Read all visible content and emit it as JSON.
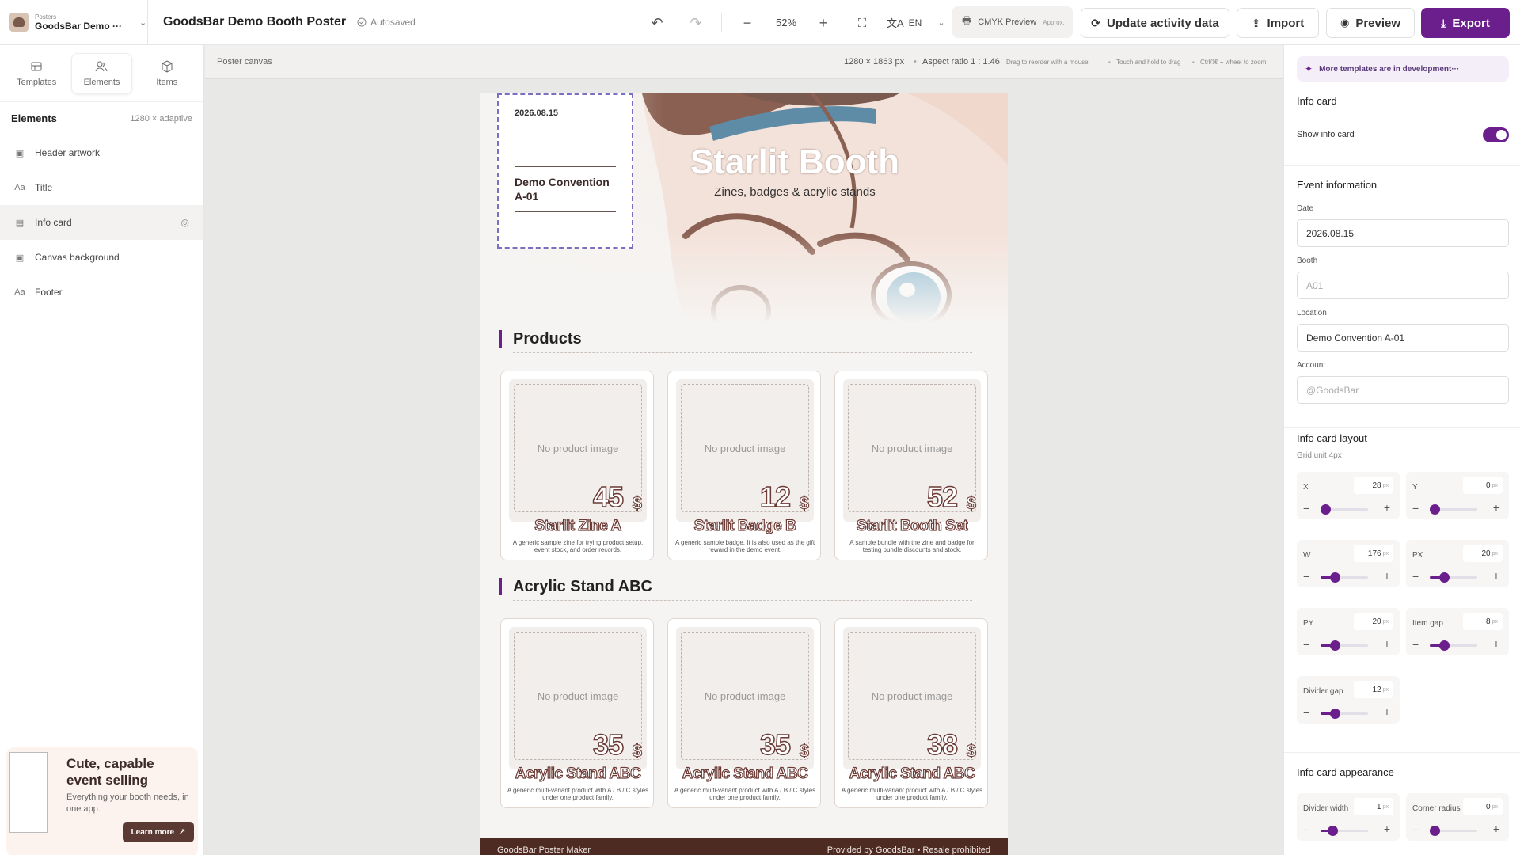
{
  "topbar": {
    "project_small": "Posters",
    "project_name": "GoodsBar Demo ···",
    "doc_title": "GoodsBar Demo Booth Poster",
    "autosaved": "Autosaved",
    "zoom": "52%",
    "lang": "EN",
    "cmyk_label": "CMYK Preview",
    "cmyk_note": "Approx.",
    "update_label": "Update activity data",
    "import_label": "Import",
    "preview_label": "Preview",
    "export_label": "Export",
    "accent_color": "#6b1f8c"
  },
  "left": {
    "tabs": [
      {
        "label": "Templates",
        "icon": "layout-icon"
      },
      {
        "label": "Elements",
        "icon": "elements-icon"
      },
      {
        "label": "Items",
        "icon": "box-icon"
      }
    ],
    "elements_title": "Elements",
    "elements_meta": "1280 × adaptive",
    "items": [
      {
        "label": "Header artwork",
        "icon": "image-icon"
      },
      {
        "label": "Title",
        "icon": "text-icon"
      },
      {
        "label": "Info card",
        "icon": "card-icon"
      },
      {
        "label": "Canvas background",
        "icon": "image-icon"
      },
      {
        "label": "Footer",
        "icon": "text-icon"
      }
    ],
    "promo": {
      "title": "Cute, capable event selling",
      "text": "Everything your booth needs, in one app.",
      "button": "Learn more"
    }
  },
  "canvas": {
    "label": "Poster canvas",
    "size": "1280 × 1863 px",
    "aspect": "Aspect ratio 1 : 1.46",
    "hint1": "Drag to reorder with a mouse",
    "hint2": "Touch and hold to drag",
    "hint3": "Ctrl/⌘ + wheel to zoom"
  },
  "poster": {
    "title": "Starlit Booth",
    "subtitle": "Zines, badges & acrylic stands",
    "info_date": "2026.08.15",
    "info_location": "Demo Convention A-01",
    "no_image": "No product image",
    "currency": "$",
    "sections": [
      {
        "title": "Products",
        "products": [
          {
            "name": "Starlit Zine A",
            "price": "45",
            "desc": "A generic sample zine for trying product setup, event stock, and order records."
          },
          {
            "name": "Starlit Badge B",
            "price": "12",
            "desc": "A generic sample badge. It is also used as the gift reward in the demo event."
          },
          {
            "name": "Starlit Booth Set",
            "price": "52",
            "desc": "A sample bundle with the zine and badge for testing bundle discounts and stock."
          }
        ]
      },
      {
        "title": "Acrylic Stand ABC",
        "products": [
          {
            "name": "Acrylic Stand ABC",
            "price": "35",
            "desc": "A generic multi-variant product with A / B / C styles under one product family."
          },
          {
            "name": "Acrylic Stand ABC",
            "price": "35",
            "desc": "A generic multi-variant product with A / B / C styles under one product family."
          },
          {
            "name": "Acrylic Stand ABC",
            "price": "38",
            "desc": "A generic multi-variant product with A / B / C styles under one product family."
          }
        ]
      }
    ],
    "footer_left": "GoodsBar Poster Maker",
    "footer_right": "Provided by GoodsBar • Resale prohibited"
  },
  "right": {
    "banner": "More templates are in development···",
    "info_card_title": "Info card",
    "show_info_card": "Show info card",
    "show_info_card_on": true,
    "event_title": "Event information",
    "fields": [
      {
        "label": "Date",
        "value": "2026.08.15",
        "placeholder": ""
      },
      {
        "label": "Booth",
        "value": "",
        "placeholder": "A01"
      },
      {
        "label": "Location",
        "value": "Demo Convention A-01",
        "placeholder": ""
      },
      {
        "label": "Account",
        "value": "",
        "placeholder": "@GoodsBar"
      }
    ],
    "layout_title": "Info card layout",
    "grid_unit": "Grid unit 4px",
    "unit": "px",
    "layout_controls": [
      {
        "label": "X",
        "value": "28",
        "level": 0.1
      },
      {
        "label": "Y",
        "value": "0",
        "level": 0.1
      },
      {
        "label": "W",
        "value": "176",
        "level": 0.3
      },
      {
        "label": "PX",
        "value": "20",
        "level": 0.3
      },
      {
        "label": "PY",
        "value": "20",
        "level": 0.3
      },
      {
        "label": "Item gap",
        "value": "8",
        "level": 0.3
      },
      {
        "label": "Divider gap",
        "value": "12",
        "level": 0.3
      }
    ],
    "appearance_title": "Info card appearance",
    "appearance_controls": [
      {
        "label": "Divider width",
        "value": "1",
        "level": 0.25
      },
      {
        "label": "Corner radius",
        "value": "0",
        "level": 0.1
      }
    ]
  }
}
